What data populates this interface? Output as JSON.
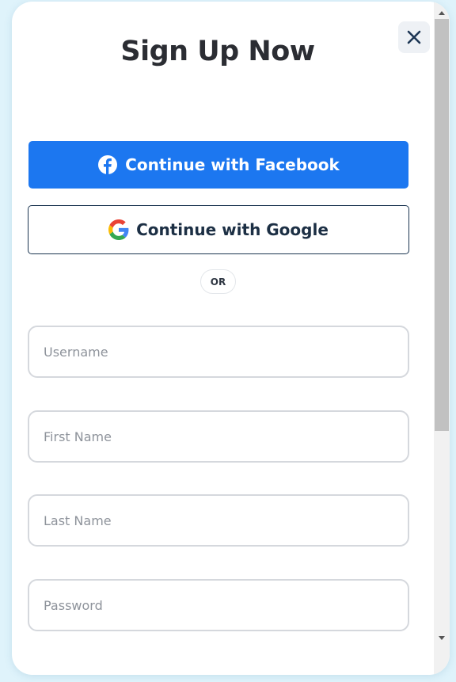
{
  "modal": {
    "title": "Sign Up Now",
    "close_icon": "close-icon"
  },
  "social": {
    "facebook_label": "Continue with Facebook",
    "facebook_icon": "facebook-icon",
    "facebook_color": "#1c77f0",
    "google_label": "Continue with Google",
    "google_icon": "google-icon"
  },
  "divider": {
    "label": "OR"
  },
  "form": {
    "username": {
      "placeholder": "Username",
      "value": ""
    },
    "first_name": {
      "placeholder": "First Name",
      "value": ""
    },
    "last_name": {
      "placeholder": "Last Name",
      "value": ""
    },
    "password": {
      "placeholder": "Password",
      "value": ""
    }
  }
}
